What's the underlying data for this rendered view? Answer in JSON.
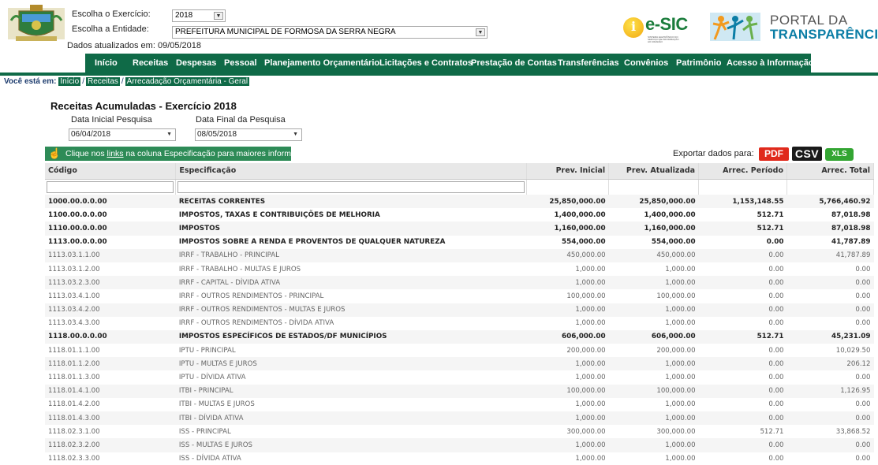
{
  "header": {
    "exercicio_label": "Escolha o Exercício:",
    "exercicio_value": "2018",
    "entidade_label": "Escolha a Entidade:",
    "entidade_value": "PREFEITURA MUNICIPAL DE FORMOSA DA SERRA NEGRA",
    "updated": "Dados atualizados em: 09/05/2018",
    "esic_text": "e-SIC",
    "esic_sub": "SISTEMA ELETRÔNICO DO SERVIÇO DE INFORMAÇÃO AO CIDADÃO",
    "portal_line1": "PORTAL DA",
    "portal_line2": "TRANSPARÊNCIA"
  },
  "nav": {
    "items": [
      "Início",
      "Receitas",
      "Despesas",
      "Pessoal",
      "Planejamento Orçamentário",
      "Licitações e Contratos",
      "Prestação de Contas",
      "Transferências",
      "Convênios",
      "Patrimônio",
      "Acesso à Informação"
    ]
  },
  "breadcrumb": {
    "label": "Você está em:",
    "items": [
      "Início",
      "Receitas",
      "Arrecadação Orçamentária - Geral"
    ]
  },
  "page": {
    "title": "Receitas Acumuladas - Exercício 2018",
    "date_start_label": "Data Inicial Pesquisa",
    "date_start_value": "06/04/2018",
    "date_end_label": "Data Final da Pesquisa",
    "date_end_value": "08/05/2018",
    "hint_pre": "Clique nos ",
    "hint_link": "links",
    "hint_post": " na coluna Especificação para maiores informações.",
    "export_label": "Exportar dados para:",
    "export_pdf": "PDF",
    "export_csv": "CSV",
    "export_xls": "XLS"
  },
  "colors": {
    "nav_green": "#0f6a47",
    "hint_green": "#2e8b57",
    "pdf_red": "#e02a1c",
    "xls_green": "#33a532",
    "portal_blue": "#0c7ea6"
  },
  "table": {
    "headers": [
      "Código",
      "Especificação",
      "Prev. Inicial",
      "Prev. Atualizada",
      "Arrec. Período",
      "Arrec. Total"
    ],
    "rows": [
      {
        "bold": true,
        "cells": [
          "1000.00.0.0.00",
          "RECEITAS CORRENTES",
          "25,850,000.00",
          "25,850,000.00",
          "1,153,148.55",
          "5,766,460.92"
        ]
      },
      {
        "bold": true,
        "cells": [
          "1100.00.0.0.00",
          "IMPOSTOS, TAXAS E CONTRIBUIÇÕES DE MELHORIA",
          "1,400,000.00",
          "1,400,000.00",
          "512.71",
          "87,018.98"
        ]
      },
      {
        "bold": true,
        "cells": [
          "1110.00.0.0.00",
          "IMPOSTOS",
          "1,160,000.00",
          "1,160,000.00",
          "512.71",
          "87,018.98"
        ]
      },
      {
        "bold": true,
        "cells": [
          "1113.00.0.0.00",
          "IMPOSTOS SOBRE A RENDA E PROVENTOS DE QUALQUER NATUREZA",
          "554,000.00",
          "554,000.00",
          "0.00",
          "41,787.89"
        ]
      },
      {
        "bold": false,
        "cells": [
          "1113.03.1.1.00",
          "IRRF - TRABALHO - PRINCIPAL",
          "450,000.00",
          "450,000.00",
          "0.00",
          "41,787.89"
        ]
      },
      {
        "bold": false,
        "cells": [
          "1113.03.1.2.00",
          "IRRF - TRABALHO - MULTAS E JUROS",
          "1,000.00",
          "1,000.00",
          "0.00",
          "0.00"
        ]
      },
      {
        "bold": false,
        "cells": [
          "1113.03.2.3.00",
          "IRRF - CAPITAL - DÍVIDA ATIVA",
          "1,000.00",
          "1,000.00",
          "0.00",
          "0.00"
        ]
      },
      {
        "bold": false,
        "cells": [
          "1113.03.4.1.00",
          "IRRF - OUTROS RENDIMENTOS - PRINCIPAL",
          "100,000.00",
          "100,000.00",
          "0.00",
          "0.00"
        ]
      },
      {
        "bold": false,
        "cells": [
          "1113.03.4.2.00",
          "IRRF - OUTROS RENDIMENTOS - MULTAS E JUROS",
          "1,000.00",
          "1,000.00",
          "0.00",
          "0.00"
        ]
      },
      {
        "bold": false,
        "cells": [
          "1113.03.4.3.00",
          "IRRF - OUTROS RENDIMENTOS - DÍVIDA ATIVA",
          "1,000.00",
          "1,000.00",
          "0.00",
          "0.00"
        ]
      },
      {
        "bold": true,
        "cells": [
          "1118.00.0.0.00",
          "IMPOSTOS ESPECÍFICOS DE ESTADOS/DF MUNICÍPIOS",
          "606,000.00",
          "606,000.00",
          "512.71",
          "45,231.09"
        ]
      },
      {
        "bold": false,
        "cells": [
          "1118.01.1.1.00",
          "IPTU - PRINCIPAL",
          "200,000.00",
          "200,000.00",
          "0.00",
          "10,029.50"
        ]
      },
      {
        "bold": false,
        "cells": [
          "1118.01.1.2.00",
          "IPTU - MULTAS E JUROS",
          "1,000.00",
          "1,000.00",
          "0.00",
          "206.12"
        ]
      },
      {
        "bold": false,
        "cells": [
          "1118.01.1.3.00",
          "IPTU - DÍVIDA ATIVA",
          "1,000.00",
          "1,000.00",
          "0.00",
          "0.00"
        ]
      },
      {
        "bold": false,
        "cells": [
          "1118.01.4.1.00",
          "ITBI - PRINCIPAL",
          "100,000.00",
          "100,000.00",
          "0.00",
          "1,126.95"
        ]
      },
      {
        "bold": false,
        "cells": [
          "1118.01.4.2.00",
          "ITBI - MULTAS E JUROS",
          "1,000.00",
          "1,000.00",
          "0.00",
          "0.00"
        ]
      },
      {
        "bold": false,
        "cells": [
          "1118.01.4.3.00",
          "ITBI - DÍVIDA ATIVA",
          "1,000.00",
          "1,000.00",
          "0.00",
          "0.00"
        ]
      },
      {
        "bold": false,
        "cells": [
          "1118.02.3.1.00",
          "ISS - PRINCIPAL",
          "300,000.00",
          "300,000.00",
          "512.71",
          "33,868.52"
        ]
      },
      {
        "bold": false,
        "cells": [
          "1118.02.3.2.00",
          "ISS - MULTAS E JUROS",
          "1,000.00",
          "1,000.00",
          "0.00",
          "0.00"
        ]
      },
      {
        "bold": false,
        "cells": [
          "1118.02.3.3.00",
          "ISS - DÍVIDA ATIVA",
          "1,000.00",
          "1,000.00",
          "0.00",
          "0.00"
        ]
      }
    ]
  }
}
